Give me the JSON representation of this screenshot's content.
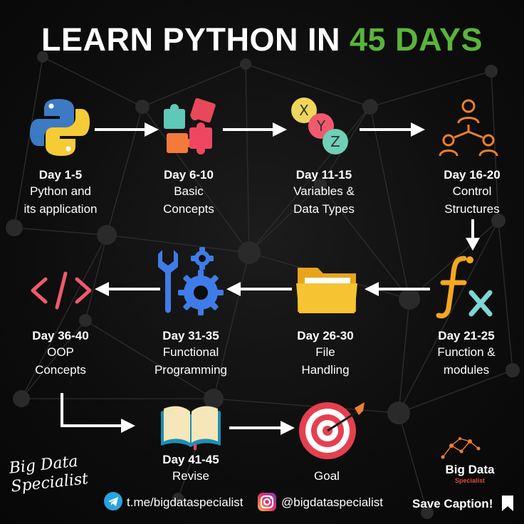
{
  "title": {
    "main": "LEARN PYTHON IN ",
    "accent": "45 DAYS"
  },
  "colors": {
    "accent": "#5ab43a",
    "background": "#0b0b0b",
    "text": "#ffffff"
  },
  "steps": [
    {
      "day": "Day 1-5",
      "desc": "Python and\nits application",
      "icon": "python-logo-icon"
    },
    {
      "day": "Day 6-10",
      "desc": "Basic\nConcepts",
      "icon": "puzzle-icon"
    },
    {
      "day": "Day 11-15",
      "desc": "Variables &\nData Types",
      "icon": "xyz-variables-icon"
    },
    {
      "day": "Day 16-20",
      "desc": "Control\nStructures",
      "icon": "hierarchy-people-icon"
    },
    {
      "day": "Day 21-25",
      "desc": "Function &\nmodules",
      "icon": "function-fx-icon"
    },
    {
      "day": "Day 26-30",
      "desc": "File\nHandling",
      "icon": "folder-icon"
    },
    {
      "day": "Day 31-35",
      "desc": "Functional\nProgramming",
      "icon": "wrench-gears-icon"
    },
    {
      "day": "Day 36-40",
      "desc": "OOP\nConcepts",
      "icon": "code-brackets-icon"
    },
    {
      "day": "Day 41-45",
      "desc": "Revise",
      "icon": "open-book-icon"
    },
    {
      "day": "",
      "desc": "Goal",
      "icon": "target-icon"
    }
  ],
  "footer": {
    "brand_script": "Big Data\nSpecialist",
    "telegram": "t.me/bigdataspecialist",
    "instagram": "@bigdataspecialist",
    "logo_name": "Big Data",
    "logo_sub": "Specialist",
    "save_caption": "Save Caption!"
  }
}
